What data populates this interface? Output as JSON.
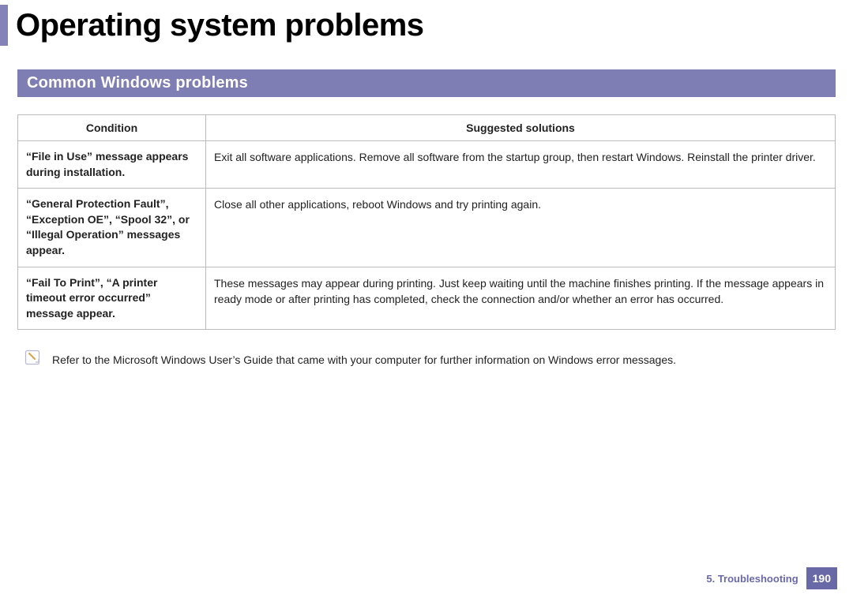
{
  "title": "Operating system problems",
  "section_heading": "Common Windows problems",
  "table": {
    "headers": [
      "Condition",
      "Suggested solutions"
    ],
    "rows": [
      {
        "condition": "“File in Use” message appears during installation.",
        "solution": "Exit all software applications. Remove all software from the startup group, then restart Windows. Reinstall the printer driver."
      },
      {
        "condition": "“General Protection Fault”, “Exception OE”, “Spool 32”, or “Illegal Operation” messages appear.",
        "solution": "Close all other applications, reboot Windows and try printing again."
      },
      {
        "condition": "“Fail To Print”, “A printer timeout error occurred” message appear.",
        "solution": "These messages may appear during printing. Just keep waiting until the machine finishes printing. If the message appears in ready mode or after printing has completed, check the connection and/or whether an error has occurred."
      }
    ]
  },
  "note": "Refer to the Microsoft Windows User’s Guide that came with your computer for further information on Windows error messages.",
  "footer": {
    "chapter": "5.  Troubleshooting",
    "page": "190"
  }
}
